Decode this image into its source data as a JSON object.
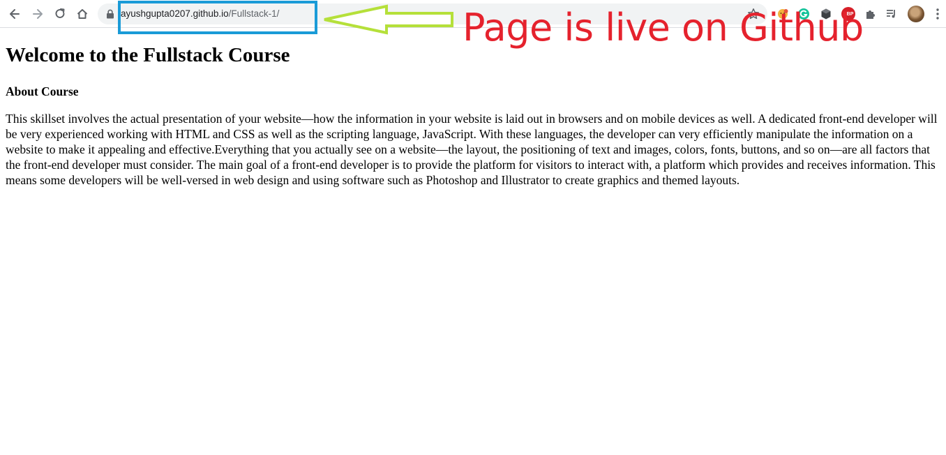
{
  "browser": {
    "url_domain": "ayushgupta0207.github.io",
    "url_path": "/Fullstack-1/",
    "extensions": {
      "abp_label": "ABP"
    }
  },
  "annotation": {
    "text": "Page is live on Github",
    "text_color": "#e5222d",
    "box_color": "#1a9bd7",
    "arrow_color": "#b5e03a"
  },
  "page": {
    "title": "Welcome to the Fullstack Course",
    "section_title": "About Course",
    "paragraph": "This skillset involves the actual presentation of your website—how the information in your website is laid out in browsers and on mobile devices as well. A dedicated front-end developer will be very experienced working with HTML and CSS as well as the scripting language, JavaScript. With these languages, the developer can very efficiently manipulate the information on a website to make it appealing and effective.Everything that you actually see on a website—the layout, the positioning of text and images, colors, fonts, buttons, and so on—are all factors that the front-end developer must consider. The main goal of a front-end developer is to provide the platform for visitors to interact with, a platform which provides and receives information. This means some developers will be well-versed in web design and using software such as Photoshop and Illustrator to create graphics and themed layouts."
  },
  "icons": {
    "back": "back-arrow-icon",
    "forward": "forward-arrow-icon",
    "reload": "reload-icon",
    "home": "home-icon",
    "lock": "lock-icon",
    "star": "star-icon",
    "extensions": "puzzle-icon",
    "media": "media-queue-icon",
    "menu": "three-dot-menu-icon"
  }
}
